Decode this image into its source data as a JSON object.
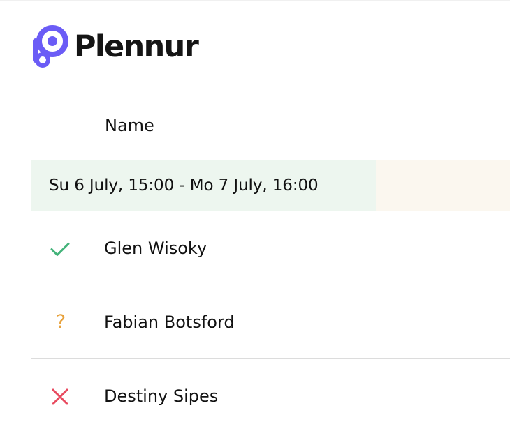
{
  "app": {
    "brand_name": "Plennur",
    "brand_color": "#6b5cf6"
  },
  "table": {
    "column_header": "Name",
    "time_slot": "Su 6 July, 15:00 - Mo 7 July, 16:00",
    "participants": [
      {
        "name": "Glen Wisoky",
        "status": "yes",
        "icon": "check-icon",
        "color": "#43b37a"
      },
      {
        "name": "Fabian Botsford",
        "status": "maybe",
        "icon": "question-icon",
        "symbol": "?",
        "color": "#e7a13b"
      },
      {
        "name": "Destiny Sipes",
        "status": "no",
        "icon": "close-icon",
        "color": "#e84a5f"
      }
    ]
  },
  "colors": {
    "selected_slot_background": "#edf6ef",
    "neighbor_slot_background": "#fbf7ef",
    "divider": "#dcdcdc"
  }
}
